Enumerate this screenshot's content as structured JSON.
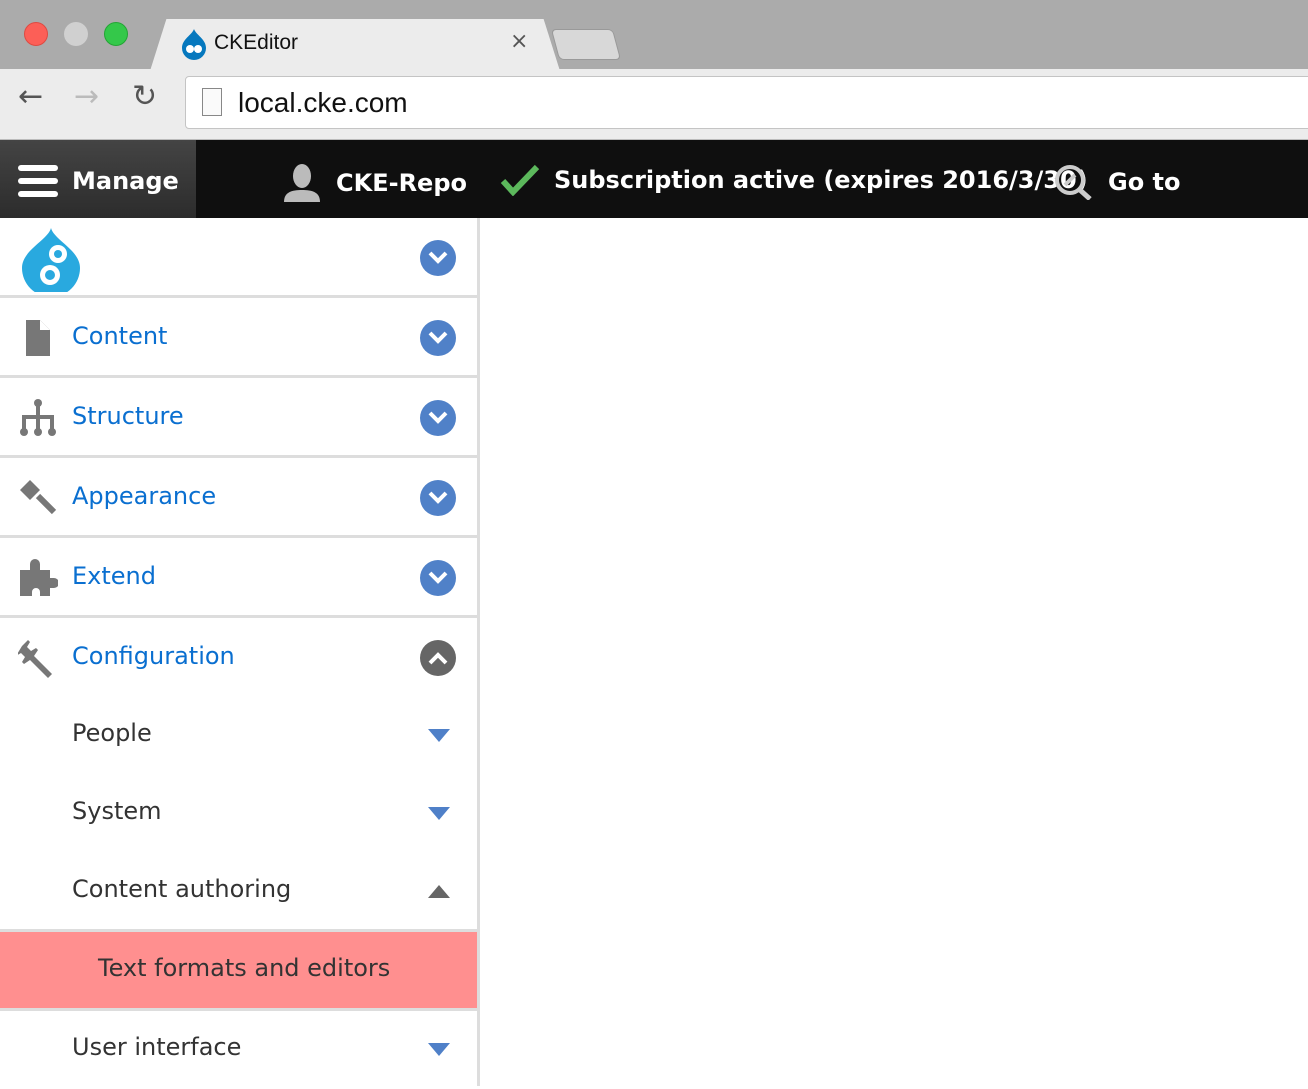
{
  "browser": {
    "tab_title": "CKEditor",
    "tab_close": "×",
    "url": "local.cke.com"
  },
  "admin_toolbar": {
    "manage": "Manage",
    "user": "CKE-Repo",
    "subscription": "Subscription active (expires 2016/3/30)",
    "goto": "Go to"
  },
  "sidebar": {
    "items": [
      {
        "label": "Content",
        "icon": "document-icon"
      },
      {
        "label": "Structure",
        "icon": "sitemap-icon"
      },
      {
        "label": "Appearance",
        "icon": "paintbrush-icon"
      },
      {
        "label": "Extend",
        "icon": "puzzle-icon"
      },
      {
        "label": "Configuration",
        "icon": "wrench-icon",
        "expanded": true
      }
    ],
    "subitems": [
      {
        "label": "People"
      },
      {
        "label": "System"
      },
      {
        "label": "Content authoring",
        "expanded": true
      },
      {
        "label": "Text formats and editors",
        "active": true
      },
      {
        "label": "User interface"
      }
    ]
  },
  "colors": {
    "link": "#0a6fd0",
    "toggle": "#5081c8",
    "active_bg": "#ff8f8f",
    "check": "#5cb85c"
  }
}
